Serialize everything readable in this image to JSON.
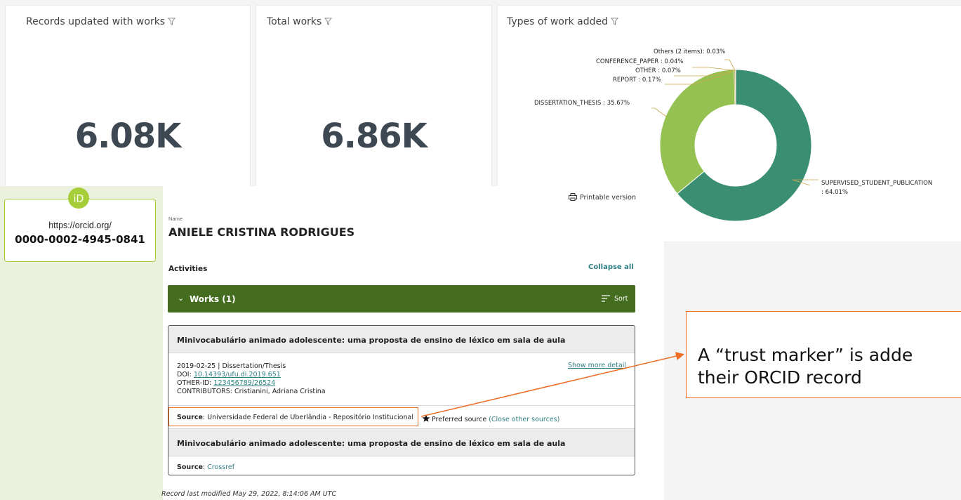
{
  "dashboard": {
    "cards": [
      {
        "title": "Records updated with works",
        "value": "6.08K"
      },
      {
        "title": "Total works",
        "value": "6.86K"
      }
    ],
    "pie_card": {
      "title": "Types of work added",
      "labels": {
        "others": "Others (2 items): 0.03%",
        "conference": "CONFERENCE_PAPER : 0.04%",
        "other": "OTHER : 0.07%",
        "report": "REPORT : 0.17%",
        "dissertation": "DISSERTATION_THESIS : 35.67%",
        "supervised_1": "SUPERVISED_STUDENT_PUBLICATION",
        "supervised_2": ": 64.01%"
      }
    },
    "chart_data": {
      "type": "pie",
      "title": "Types of work added",
      "slices": [
        {
          "label": "SUPERVISED_STUDENT_PUBLICATION",
          "value": 64.01,
          "color": "#3a8f73"
        },
        {
          "label": "DISSERTATION_THESIS",
          "value": 35.67,
          "color": "#95c152"
        },
        {
          "label": "REPORT",
          "value": 0.17,
          "color": "#c8a64a"
        },
        {
          "label": "OTHER",
          "value": 0.07,
          "color": "#d8b860"
        },
        {
          "label": "CONFERENCE_PAPER",
          "value": 0.04,
          "color": "#e3c070"
        },
        {
          "label": "Others (2 items)",
          "value": 0.03,
          "color": "#efd090"
        }
      ]
    }
  },
  "orcid": {
    "logo": "iD",
    "url": "https://orcid.org/",
    "id": "0000-0002-4945-0841"
  },
  "record": {
    "printable": "Printable version",
    "name_caption": "Name",
    "name": "ANIELE CRISTINA RODRIGUES",
    "activities": "Activities",
    "collapse_all": "Collapse all",
    "works_header": "Works (1)",
    "sort": "Sort",
    "work_title": "Minivocabulário animado adolescente: uma proposta de ensino de léxico em sala de aula",
    "date_type": "2019-02-25 | Dissertation/Thesis",
    "doi_label": "DOI: ",
    "doi": "10.14393/ufu.di.2019.651",
    "other_id_label": "OTHER-ID: ",
    "other_id": "123456789/26524",
    "contributors": "CONTRIBUTORS: Cristianini, Adriana Cristina",
    "show_more": "Show more detail",
    "source_label": "Source",
    "source_1": ": Universidade Federal de Uberlândia - Repositório Institucional",
    "preferred": "Preferred source",
    "close_other": "(Close other sources)",
    "source_2": "Crossref",
    "last_modified": "Record last modified May 29, 2022, 8:14:06 AM UTC"
  },
  "callout": {
    "line1": "A “trust marker” is adde",
    "line2": "their ORCID record",
    "color": "#ee6b22"
  }
}
